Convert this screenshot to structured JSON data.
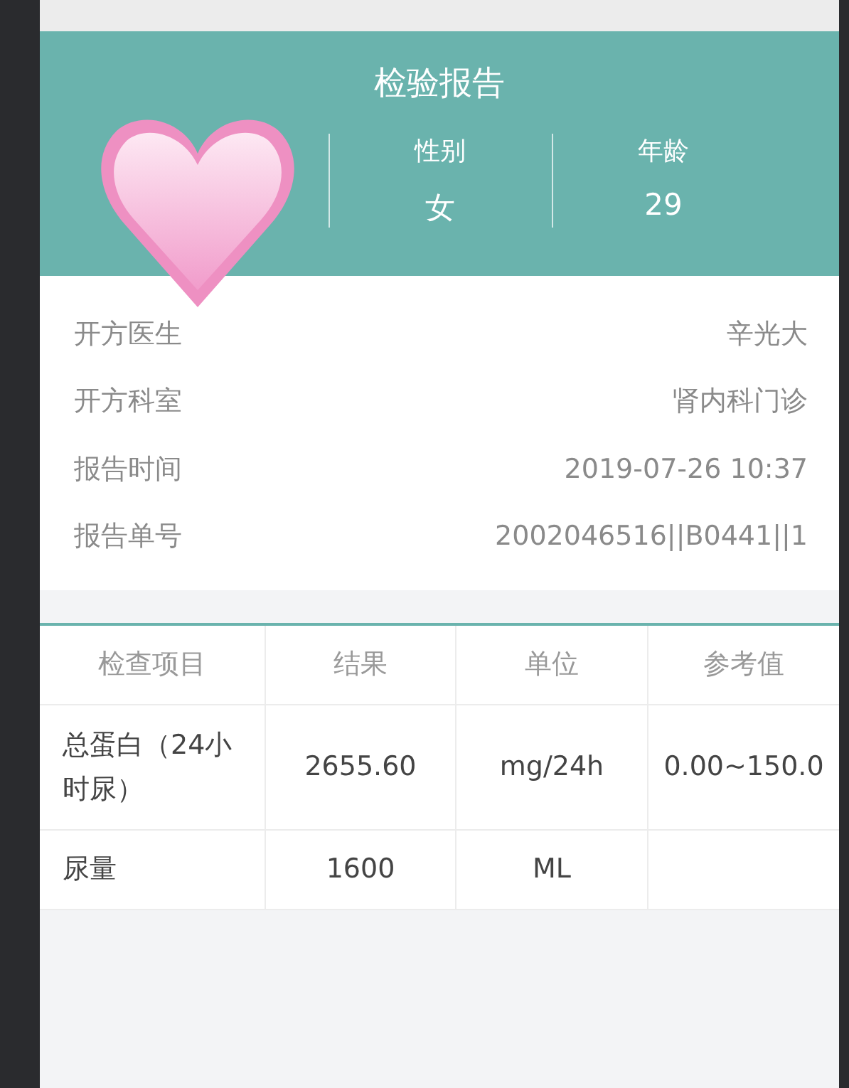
{
  "header": {
    "title": "检验报告",
    "patient": [
      {
        "label": "性别",
        "value": "女"
      },
      {
        "label": "年龄",
        "value": "29"
      }
    ]
  },
  "info": [
    {
      "label": "开方医生",
      "value": "辛光大"
    },
    {
      "label": "开方科室",
      "value": "肾内科门诊"
    },
    {
      "label": "报告时间",
      "value": "2019-07-26 10:37"
    },
    {
      "label": "报告单号",
      "value": "2002046516||B0441||1"
    }
  ],
  "table": {
    "columns": [
      "检查项目",
      "结果",
      "单位",
      "参考值"
    ],
    "rows": [
      [
        "总蛋白（24小时尿）",
        "2655.60",
        "mg/24h",
        "0.00~150.0"
      ],
      [
        "尿量",
        "1600",
        "ML",
        ""
      ]
    ]
  }
}
